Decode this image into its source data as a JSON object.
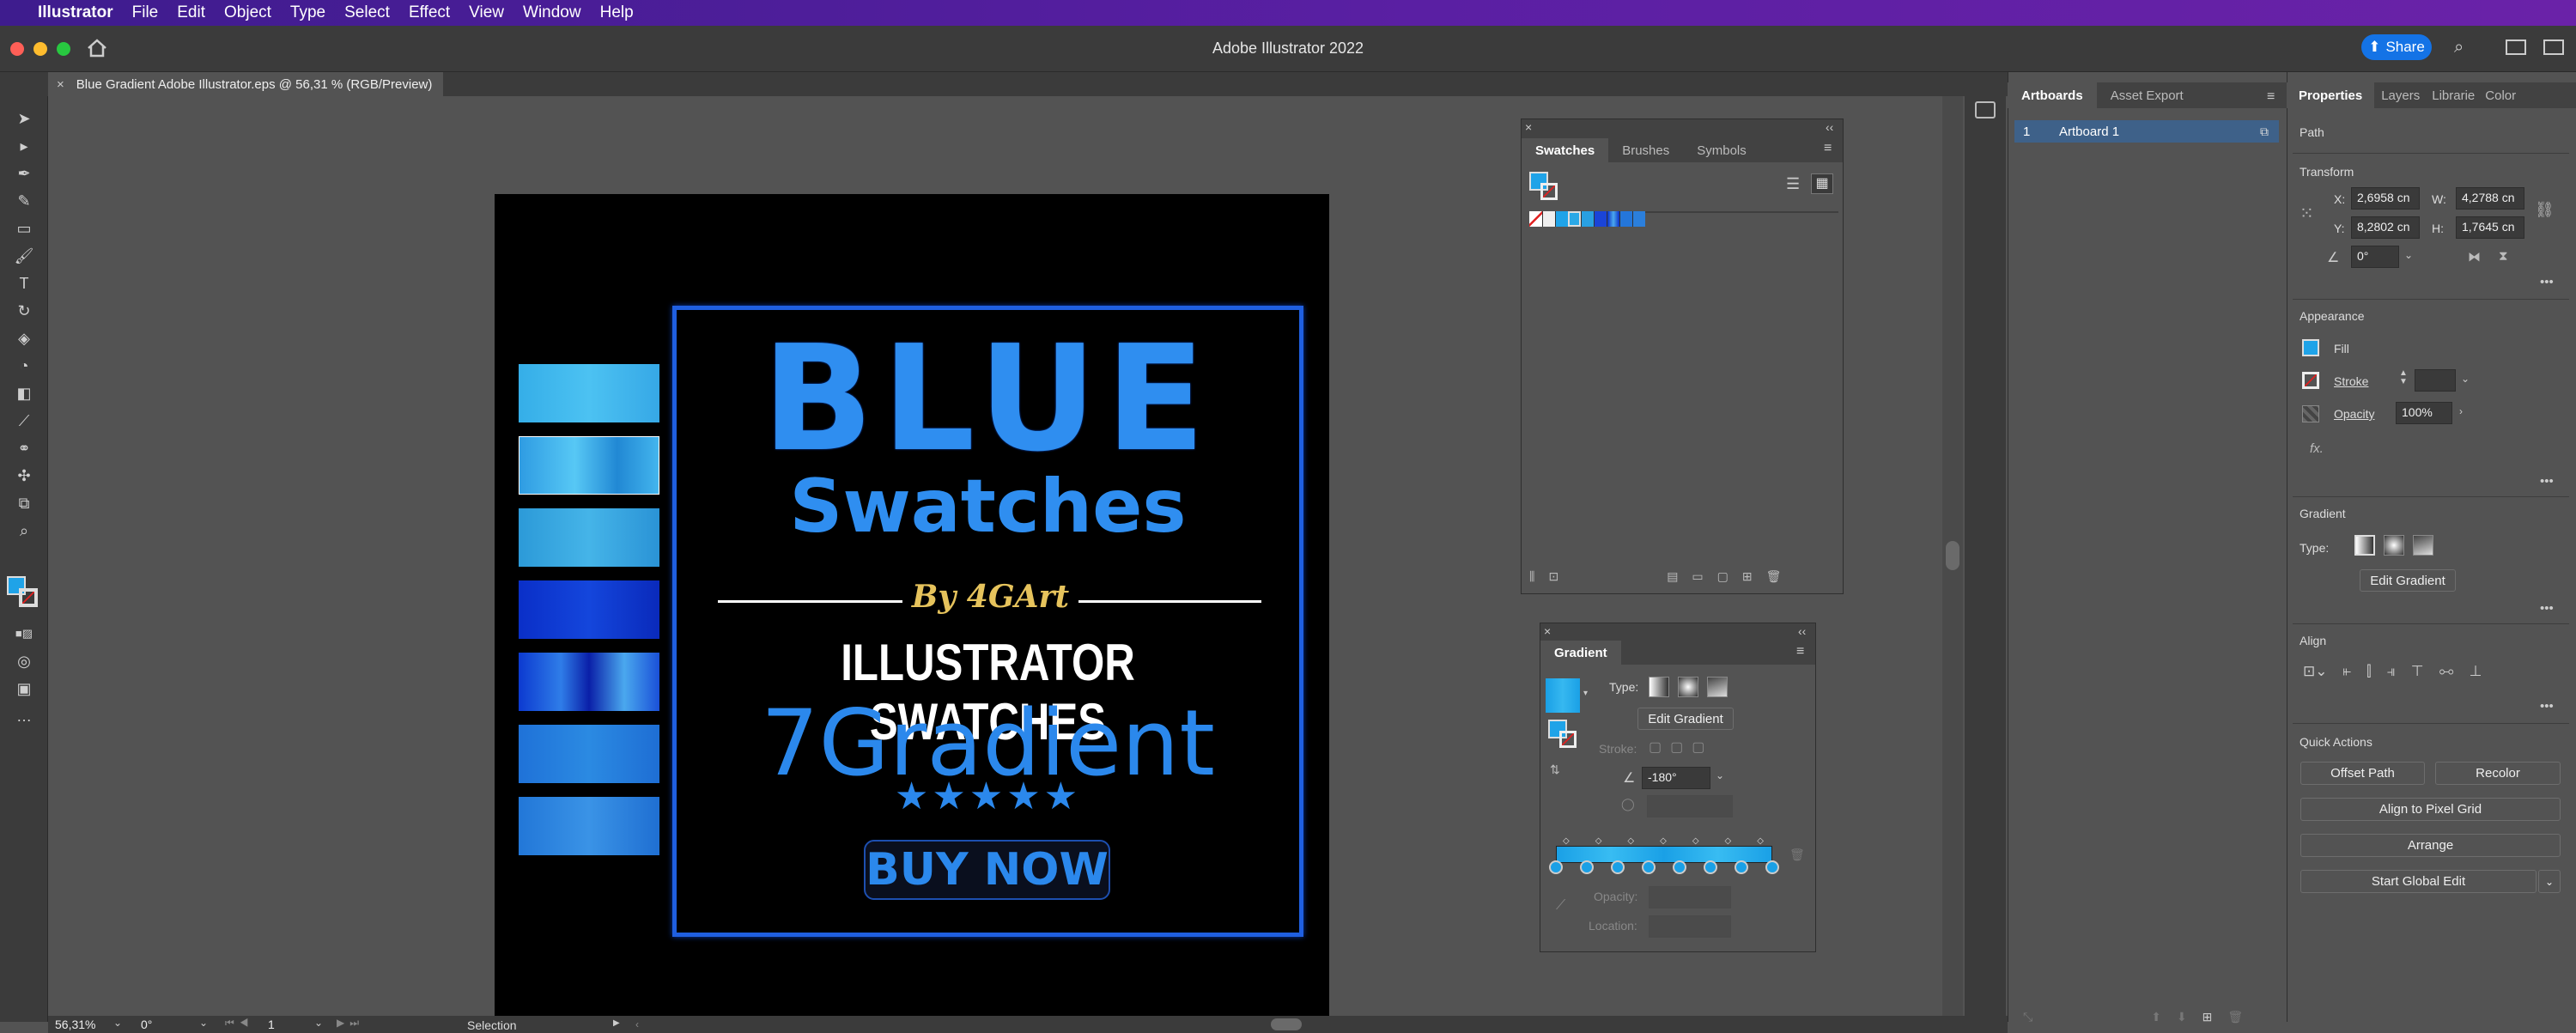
{
  "menubar": {
    "app_name": "Illustrator",
    "items": [
      "File",
      "Edit",
      "Object",
      "Type",
      "Select",
      "Effect",
      "View",
      "Window",
      "Help"
    ]
  },
  "titlebar": {
    "title": "Adobe Illustrator 2022",
    "share_label": "Share"
  },
  "document_tab": {
    "label": "Blue Gradient Adobe Illustrator.eps @ 56,31 % (RGB/Preview)"
  },
  "artwork": {
    "title_big": "BLUE",
    "title_sub": "Swatches",
    "byline": "By 4GArt",
    "heading": "ILLUSTRATOR SWATCHES",
    "gradient_text": "7Gradient",
    "stars": "★★★★★",
    "cta": "BUY NOW",
    "colors": {
      "frame": "#1f5fe0",
      "bar_light": "#3fb4ee",
      "bar_dark": "#0a2fc8"
    }
  },
  "swatches_panel": {
    "tabs": [
      "Swatches",
      "Brushes",
      "Symbols"
    ]
  },
  "gradient_panel": {
    "title": "Gradient",
    "type_label": "Type:",
    "edit_button": "Edit Gradient",
    "stroke_label": "Stroke:",
    "angle_value": "-180°",
    "opacity_label": "Opacity:",
    "location_label": "Location:"
  },
  "artboards_panel": {
    "tabs": [
      "Artboards",
      "Asset Export"
    ],
    "rows": [
      {
        "index": "1",
        "name": "Artboard 1"
      }
    ]
  },
  "properties": {
    "tabs": [
      "Properties",
      "Layers",
      "Librarie",
      "Color"
    ],
    "selection_type": "Path",
    "transform": {
      "title": "Transform",
      "x_label": "X:",
      "x_value": "2,6958 cn",
      "y_label": "Y:",
      "y_value": "8,2802 cn",
      "w_label": "W:",
      "w_value": "4,2788 cn",
      "h_label": "H:",
      "h_value": "1,7645 cn",
      "angle_value": "0°"
    },
    "appearance": {
      "title": "Appearance",
      "fill_label": "Fill",
      "stroke_label": "Stroke",
      "opacity_label": "Opacity",
      "opacity_value": "100%",
      "fx_label": "fx."
    },
    "gradient": {
      "title": "Gradient",
      "type_label": "Type:",
      "edit_button": "Edit Gradient"
    },
    "align": {
      "title": "Align"
    },
    "quick_actions": {
      "title": "Quick Actions",
      "offset_path": "Offset Path",
      "recolor": "Recolor",
      "align_pixel": "Align to Pixel Grid",
      "arrange": "Arrange",
      "global_edit": "Start Global Edit"
    }
  },
  "statusbar": {
    "zoom": "56,31%",
    "rotate": "0°",
    "artboard_num": "1",
    "tool": "Selection"
  }
}
